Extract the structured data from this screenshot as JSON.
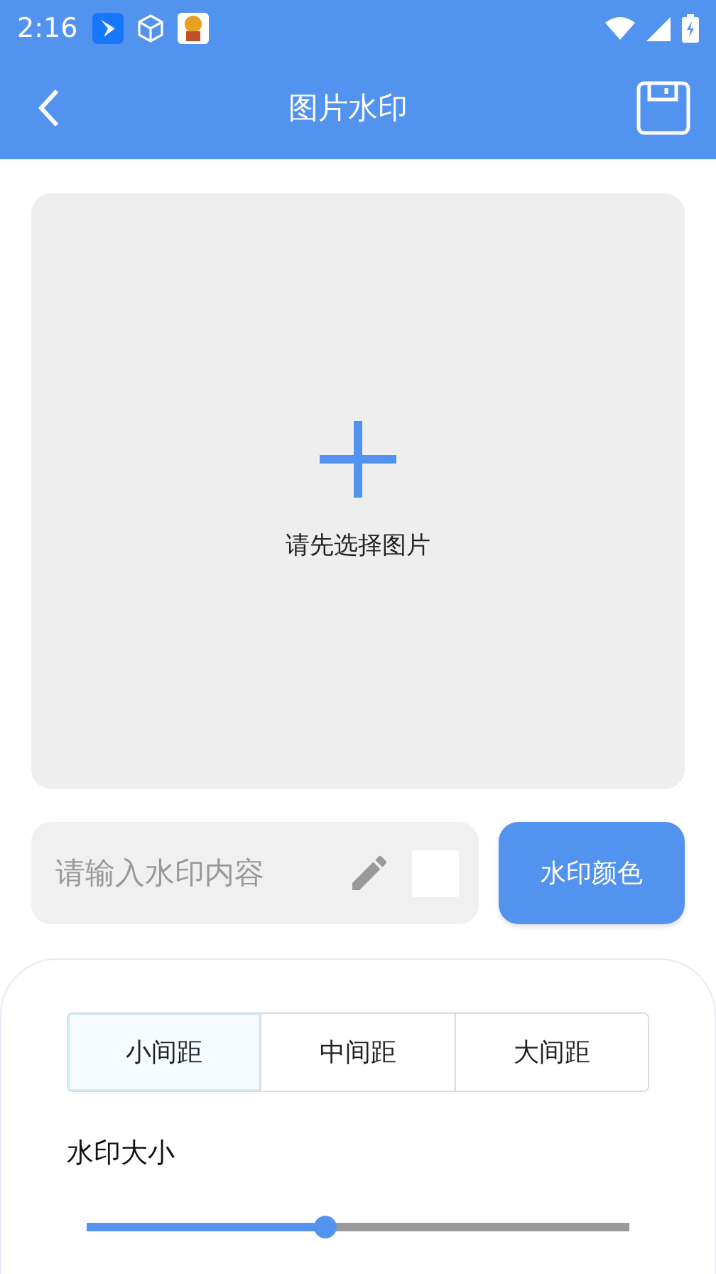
{
  "status_bar": {
    "time": "2:16"
  },
  "header": {
    "title": "图片水印"
  },
  "image_area": {
    "hint": "请先选择图片"
  },
  "watermark_input": {
    "placeholder": "请输入水印内容",
    "color": "#ffffff"
  },
  "color_button": {
    "label": "水印颜色"
  },
  "spacing_tabs": [
    {
      "label": "小间距",
      "selected": true
    },
    {
      "label": "中间距",
      "selected": false
    },
    {
      "label": "大间距",
      "selected": false
    }
  ],
  "size_slider": {
    "label": "水印大小",
    "level": 0.44
  }
}
